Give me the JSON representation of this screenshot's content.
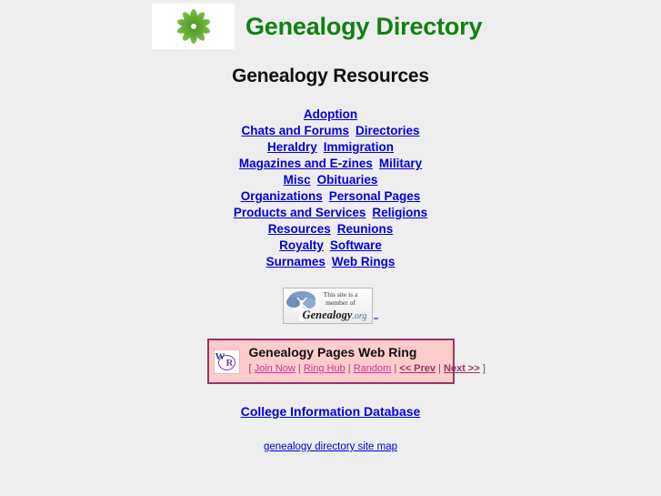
{
  "header": {
    "logo_alt": "green-flower-logo",
    "title": "Genealogy Directory"
  },
  "main": {
    "heading": "Genealogy Resources",
    "link_rows": [
      [
        "Adoption"
      ],
      [
        "Chats and Forums",
        "Directories"
      ],
      [
        "Heraldry",
        "Immigration"
      ],
      [
        "Magazines and E-zines",
        "Military"
      ],
      [
        "Misc",
        "Obituaries"
      ],
      [
        "Organizations",
        "Personal Pages"
      ],
      [
        "Products and Services",
        "Religions"
      ],
      [
        "Resources",
        "Reunions"
      ],
      [
        "Royalty",
        "Software"
      ],
      [
        "Surnames",
        "Web Rings"
      ]
    ]
  },
  "badge": {
    "line1": "This site is a",
    "line2": "member of",
    "brand_main": "Genealogy",
    "brand_tld": ".org"
  },
  "webring": {
    "logo_w": "W",
    "logo_r": "R",
    "title": "Genealogy Pages Web Ring",
    "open_bracket": "[",
    "close_bracket": "]",
    "separator": "|",
    "links": [
      {
        "label": "Join Now",
        "strong": false
      },
      {
        "label": "Ring Hub",
        "strong": false
      },
      {
        "label": "Random",
        "strong": false
      },
      {
        "label": "<< Prev",
        "strong": true
      },
      {
        "label": "Next >>",
        "strong": true
      }
    ]
  },
  "footer": {
    "college_link": "College Information Database",
    "sitemap_link": "genealogy directory site map"
  },
  "colors": {
    "page_background": "#eeeeee",
    "title_green": "#128012",
    "link_blue": "#0000dd",
    "ring_border": "#993366",
    "ring_background": "#ffcccc",
    "ring_link": "#cc3399"
  }
}
